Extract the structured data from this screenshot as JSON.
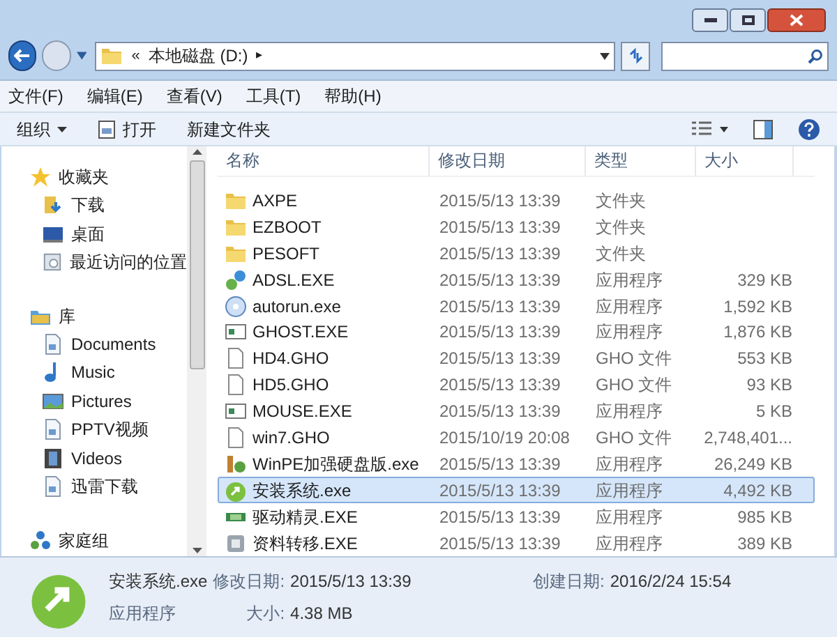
{
  "address": {
    "overflow": "«",
    "path": "本地磁盘 (D:)",
    "separator": "▸"
  },
  "menu": [
    "文件(F)",
    "编辑(E)",
    "查看(V)",
    "工具(T)",
    "帮助(H)"
  ],
  "toolbar": [
    {
      "label": "组织",
      "kind": "dropdown"
    },
    {
      "label": "打开",
      "kind": "icon"
    },
    {
      "label": "新建文件夹",
      "kind": "plain"
    }
  ],
  "sidebar": [
    {
      "label": "收藏夹",
      "kind": "star",
      "children": [
        {
          "label": "下载",
          "kind": "download"
        },
        {
          "label": "桌面",
          "kind": "desktop"
        },
        {
          "label": "最近访问的位置",
          "kind": "recent"
        }
      ]
    },
    {
      "label": "库",
      "kind": "library",
      "children": [
        {
          "label": "Documents",
          "kind": "doc"
        },
        {
          "label": "Music",
          "kind": "music"
        },
        {
          "label": "Pictures",
          "kind": "pictures"
        },
        {
          "label": "PPTV视频",
          "kind": "doc"
        },
        {
          "label": "Videos",
          "kind": "video"
        },
        {
          "label": "迅雷下载",
          "kind": "doc"
        }
      ]
    },
    {
      "label": "家庭组",
      "kind": "homegroup"
    }
  ],
  "columns": [
    "名称",
    "修改日期",
    "类型",
    "大小"
  ],
  "files": [
    {
      "name": "AXPE",
      "date": "2015/5/13 13:39",
      "type": "文件夹",
      "kind": "folder",
      "selected": false
    },
    {
      "name": "EZBOOT",
      "date": "2015/5/13 13:39",
      "type": "文件夹",
      "kind": "folder",
      "selected": false
    },
    {
      "name": "PESOFT",
      "date": "2015/5/13 13:39",
      "type": "文件夹",
      "kind": "folder",
      "selected": false
    },
    {
      "name": "ADSL.EXE",
      "date": "2015/5/13 13:39",
      "type": "应用程序",
      "size": "329 KB",
      "kind": "network",
      "selected": false
    },
    {
      "name": "autorun.exe",
      "date": "2015/5/13 13:39",
      "type": "应用程序",
      "size": "1,592 KB",
      "kind": "disc",
      "selected": false
    },
    {
      "name": "GHOST.EXE",
      "date": "2015/5/13 13:39",
      "type": "应用程序",
      "size": "1,876 KB",
      "kind": "app",
      "selected": false
    },
    {
      "name": "HD4.GHO",
      "date": "2015/5/13 13:39",
      "type": "GHO 文件",
      "size": "553 KB",
      "kind": "file",
      "selected": false
    },
    {
      "name": "HD5.GHO",
      "date": "2015/5/13 13:39",
      "type": "GHO 文件",
      "size": "93 KB",
      "kind": "file",
      "selected": false
    },
    {
      "name": "MOUSE.EXE",
      "date": "2015/5/13 13:39",
      "type": "应用程序",
      "size": "5 KB",
      "kind": "app",
      "selected": false
    },
    {
      "name": "win7.GHO",
      "date": "2015/10/19 20:08",
      "type": "GHO 文件",
      "size": "2,748,401...",
      "kind": "file",
      "selected": false
    },
    {
      "name": "WinPE加强硬盘版.exe",
      "date": "2015/5/13 13:39",
      "type": "应用程序",
      "size": "26,249 KB",
      "kind": "tools",
      "selected": false
    },
    {
      "name": "安装系统.exe",
      "date": "2015/5/13 13:39",
      "type": "应用程序",
      "size": "4,492 KB",
      "kind": "installer",
      "selected": true
    },
    {
      "name": "驱动精灵.EXE",
      "date": "2015/5/13 13:39",
      "type": "应用程序",
      "size": "985 KB",
      "kind": "card",
      "selected": false
    },
    {
      "name": "资料转移.EXE",
      "date": "2015/5/13 13:39",
      "type": "应用程序",
      "size": "389 KB",
      "kind": "box",
      "selected": false
    }
  ],
  "details": {
    "name": "安装系统.exe",
    "type": "应用程序",
    "modified_label": "修改日期:",
    "modified": "2015/5/13 13:39",
    "size_label": "大小:",
    "size": "4.38 MB",
    "created_label": "创建日期:",
    "created": "2016/2/24 15:54"
  }
}
